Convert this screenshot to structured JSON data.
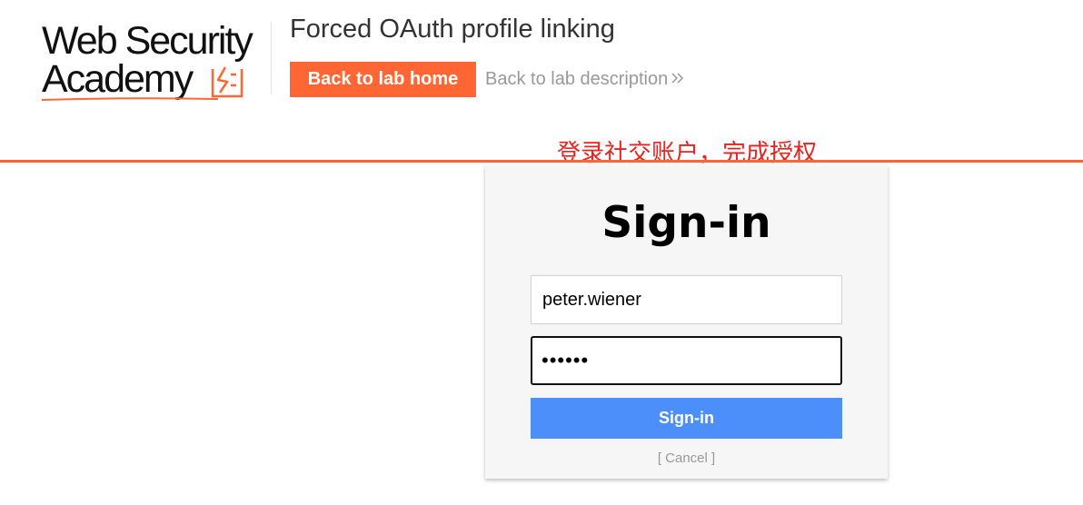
{
  "brand": {
    "logo_line1": "Web Security",
    "logo_line2": "Academy",
    "accent_color": "#ff6633"
  },
  "header": {
    "lab_title": "Forced OAuth profile linking",
    "back_home_label": "Back to lab home",
    "back_description_label": "Back to lab description",
    "chevron_icon": "double-chevron-right-icon"
  },
  "annotation": {
    "text": "登录社交账户，完成授权",
    "color": "#e8231f"
  },
  "signin_card": {
    "title": "Sign-in",
    "username_value": "peter.wiener",
    "password_masked": "••••••",
    "submit_label": "Sign-in",
    "cancel_label": "[ Cancel ]",
    "button_color": "#4c8ffb"
  }
}
